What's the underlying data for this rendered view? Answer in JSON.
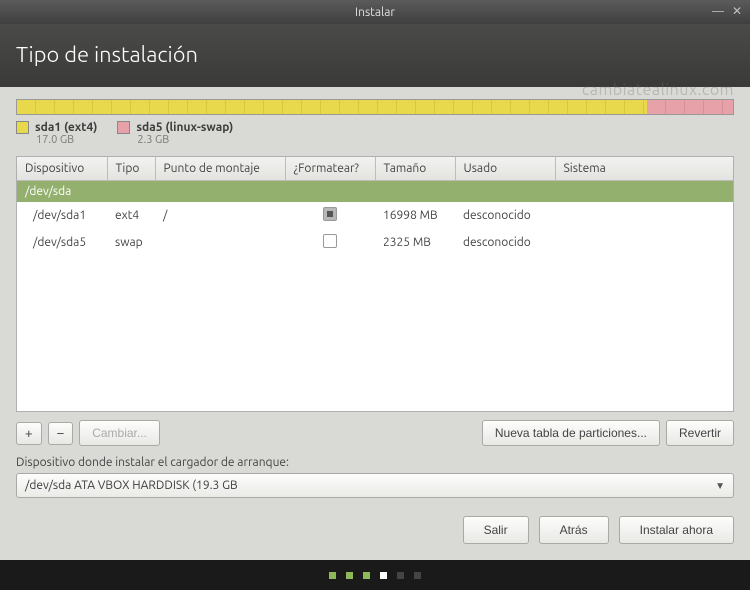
{
  "window": {
    "title": "Instalar"
  },
  "header": {
    "title": "Tipo de instalación"
  },
  "watermark": "cambiatealinux.com",
  "diskbar": {
    "segments": [
      {
        "color": "yellow",
        "pct": 88
      },
      {
        "color": "pink",
        "pct": 12
      }
    ]
  },
  "legend": [
    {
      "swatch": "yellow",
      "label": "sda1 (ext4)",
      "sub": "17.0 GB"
    },
    {
      "swatch": "pink",
      "label": "sda5 (linux-swap)",
      "sub": "2.3 GB"
    }
  ],
  "columns": {
    "device": "Dispositivo",
    "type": "Tipo",
    "mount": "Punto de montaje",
    "format": "¿Formatear?",
    "size": "Tamaño",
    "used": "Usado",
    "system": "Sistema"
  },
  "disk_row": {
    "device": "/dev/sda"
  },
  "partitions": [
    {
      "device": "/dev/sda1",
      "type": "ext4",
      "mount": "/",
      "format": true,
      "size": "16998 MB",
      "used": "desconocido",
      "system": ""
    },
    {
      "device": "/dev/sda5",
      "type": "swap",
      "mount": "",
      "format": false,
      "size": "2325 MB",
      "used": "desconocido",
      "system": ""
    }
  ],
  "toolbar": {
    "add": "+",
    "remove": "−",
    "change": "Cambiar...",
    "new_table": "Nueva tabla de particiones...",
    "revert": "Revertir"
  },
  "bootloader": {
    "label": "Dispositivo donde instalar el cargador de arranque:",
    "value": "/dev/sda   ATA VBOX HARDDISK (19.3 GB"
  },
  "footer": {
    "quit": "Salir",
    "back": "Atrás",
    "install": "Instalar ahora"
  }
}
